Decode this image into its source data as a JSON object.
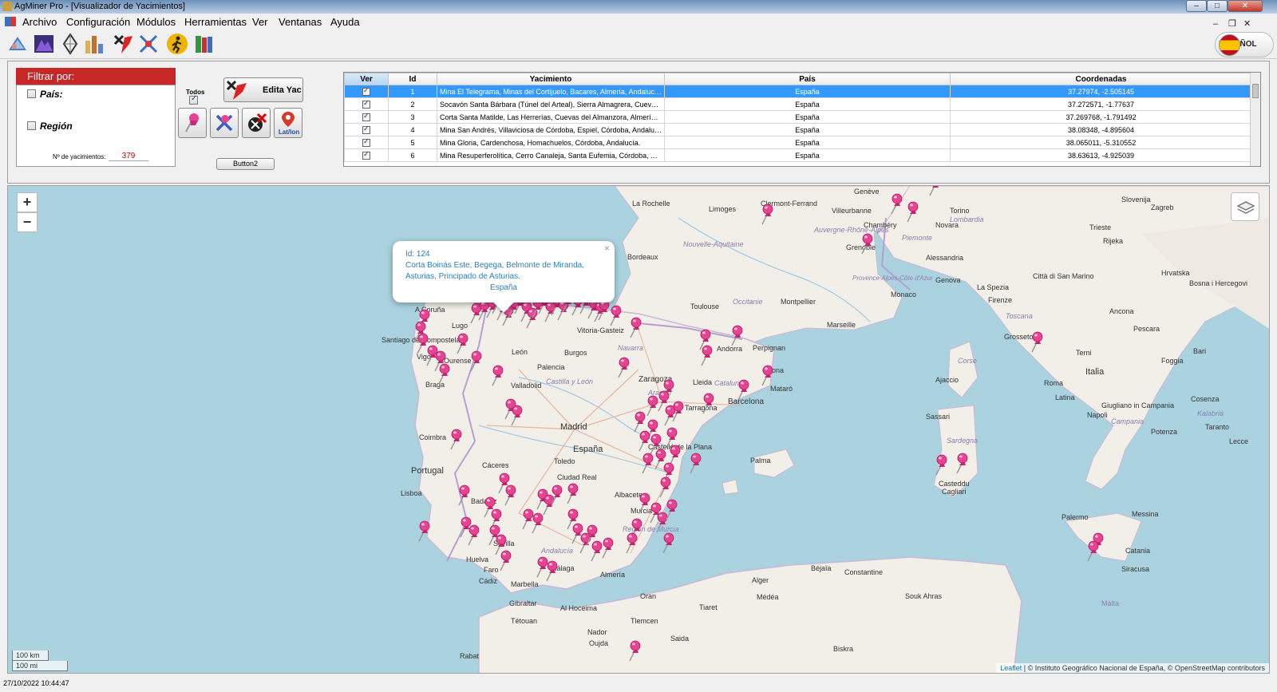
{
  "window": {
    "title": "AgMiner Pro - [Visualizador de Yacimientos]",
    "min_label": "–",
    "max_label": "□",
    "close_label": "✕"
  },
  "menu": {
    "items": [
      "Archivo",
      "Configuración",
      "Módulos",
      "Herramientas",
      "Ver",
      "Ventanas",
      "Ayuda"
    ],
    "mdi_controls": [
      "–",
      "❐",
      "✕"
    ]
  },
  "toolbar": {
    "icons": [
      "globe-map-icon",
      "mountain-icon",
      "diamond-icon",
      "bar-chart-icon",
      "mine-pin-icon",
      "miner-tools-icon",
      "runner-icon",
      "books-icon"
    ],
    "language_label": "ESPAÑOL"
  },
  "filter": {
    "header": "Filtrar por:",
    "country_label": "País:",
    "region_label": "Región",
    "count_label": "Nº de yacimientos:",
    "count_value": "379"
  },
  "actions": {
    "all_label": "Todos",
    "edit_label": "Edita Yac",
    "latlon_label": "Lat/lon",
    "button2_label": "Button2"
  },
  "grid": {
    "columns": [
      "Ver",
      "Id",
      "Yacimiento",
      "País",
      "Coordenadas"
    ],
    "rows": [
      {
        "id": "1",
        "name": "Mina El Telegrama, Minas del Cortijuelo, Bacares, Almería, Andalucía.",
        "country": "España",
        "coords": "37.27974, -2.505145"
      },
      {
        "id": "2",
        "name": "Socavón Santa Bárbara (Túnel del Arteal), Sierra Almagrera, Cuevas del Almanzora, Almería, Andalucía.",
        "country": "España",
        "coords": "37.272571, -1.77637"
      },
      {
        "id": "3",
        "name": "Corta Santa Matilde, Las Herrerías, Cuevas del Almanzora, Almería, Andalucía.",
        "country": "España",
        "coords": "37.269768, -1.791492"
      },
      {
        "id": "4",
        "name": "Mina San Andrés, Villaviciosa de Córdoba, Espiel, Córdoba, Andalucía.",
        "country": "España",
        "coords": "38.08348, -4.895604"
      },
      {
        "id": "5",
        "name": "Mina Gloria, Cardenchosa, Homachuelos, Córdoba, Andalucía.",
        "country": "España",
        "coords": "38.065011, -5.310552"
      },
      {
        "id": "6",
        "name": "Mina Resuperferolítica, Cerro Canaleja, Santa Eufemia, Córdoba, Andalucía.",
        "country": "España",
        "coords": "38.63613, -4.925039"
      }
    ]
  },
  "map": {
    "popup": {
      "id_line": "Id: 124",
      "address": "Corta Boinás Este, Begega, Belmonte de Miranda, Asturias, Principado de Asturias.",
      "country": "España",
      "close": "×"
    },
    "zoom_in": "+",
    "zoom_out": "−",
    "scale_km": "100 km",
    "scale_mi": "100 mi",
    "attribution_leaflet": "Leaflet",
    "attribution_rest": " | © Instituto Geográfico Nacional de España, © OpenStreetMap contributors",
    "places": [
      "La Rochelle",
      "Limoges",
      "Clermont-Ferrand",
      "Genève",
      "Villeurbanne",
      "Chambéry",
      "Torino",
      "Novara",
      "Grenoble",
      "Alessandria",
      "Bordeaux",
      "Nouvelle-Aquitaine",
      "Auvergne-Rhône-Alpes",
      "Piemonte",
      "Lombardia",
      "Trieste",
      "Zagreb",
      "Slovenija",
      "Rijeka",
      "Hrvatska",
      "Genova",
      "La Spezia",
      "Città di San Marino",
      "Bosna i Hercegovi",
      "Toulouse",
      "Occitanie",
      "Montpellier",
      "Monaco",
      "Marseille",
      "Provence-Alpes-Côte d'Azur",
      "Firenze",
      "Toscana",
      "Ancona",
      "Grosseto",
      "Terni",
      "Italia",
      "Roma",
      "Latina",
      "Pescara",
      "Bari",
      "Foggia",
      "Napoli",
      "Campania",
      "Giugliano in Campania",
      "Potenza",
      "Taranto",
      "Lecce",
      "Corse",
      "Ajaccio",
      "Sassari",
      "Sardegna",
      "Cagliari",
      "Casteddu",
      "Palermo",
      "Messina",
      "Catania",
      "Siracusa",
      "Màlta",
      "Bordeaux",
      "A Coruña",
      "Santiago de Compostela",
      "Lugo",
      "Vigo",
      "Ourense",
      "Braga",
      "León",
      "Burgos",
      "Vitoria-Gasteiz",
      "Navarra",
      "Andorra",
      "Perpignan",
      "Girona",
      "Mataró",
      "Barcelona",
      "Catalunya",
      "Lleida",
      "Zaragoza",
      "Aragón",
      "Palencia",
      "Valladolid",
      "Castilla y León",
      "Coimbra",
      "Portugal",
      "Madrid",
      "España",
      "Toledo",
      "Cáceres",
      "Ciudad Real",
      "Lisboa",
      "Badajoz",
      "Albacete",
      "Castelló de la Plana",
      "Tarragona",
      "Palma",
      "Sevilla",
      "Andalucía",
      "Murcia",
      "Región de Murcia",
      "Huelva",
      "Málaga",
      "Almería",
      "Cádiz",
      "Marbella",
      "Gibraltar",
      "Tétouan",
      "Al Hoceima",
      "Oran",
      "Tlemcen",
      "Alger",
      "Tiaret",
      "Médéa",
      "Béjaïa",
      "Constantine",
      "Souk Ahras",
      "Biskra",
      "Saida",
      "Oujda",
      "Rabat",
      "Nador",
      "Faro",
      "Cosenza",
      "Kalabria"
    ]
  },
  "status": {
    "datetime": "27/10/2022 10:44:47"
  },
  "colors": {
    "filter_header": "#c62828",
    "selected_row": "#3399ff",
    "sea": "#aad3df",
    "land": "#f2efe9",
    "marker": "#e84393"
  }
}
